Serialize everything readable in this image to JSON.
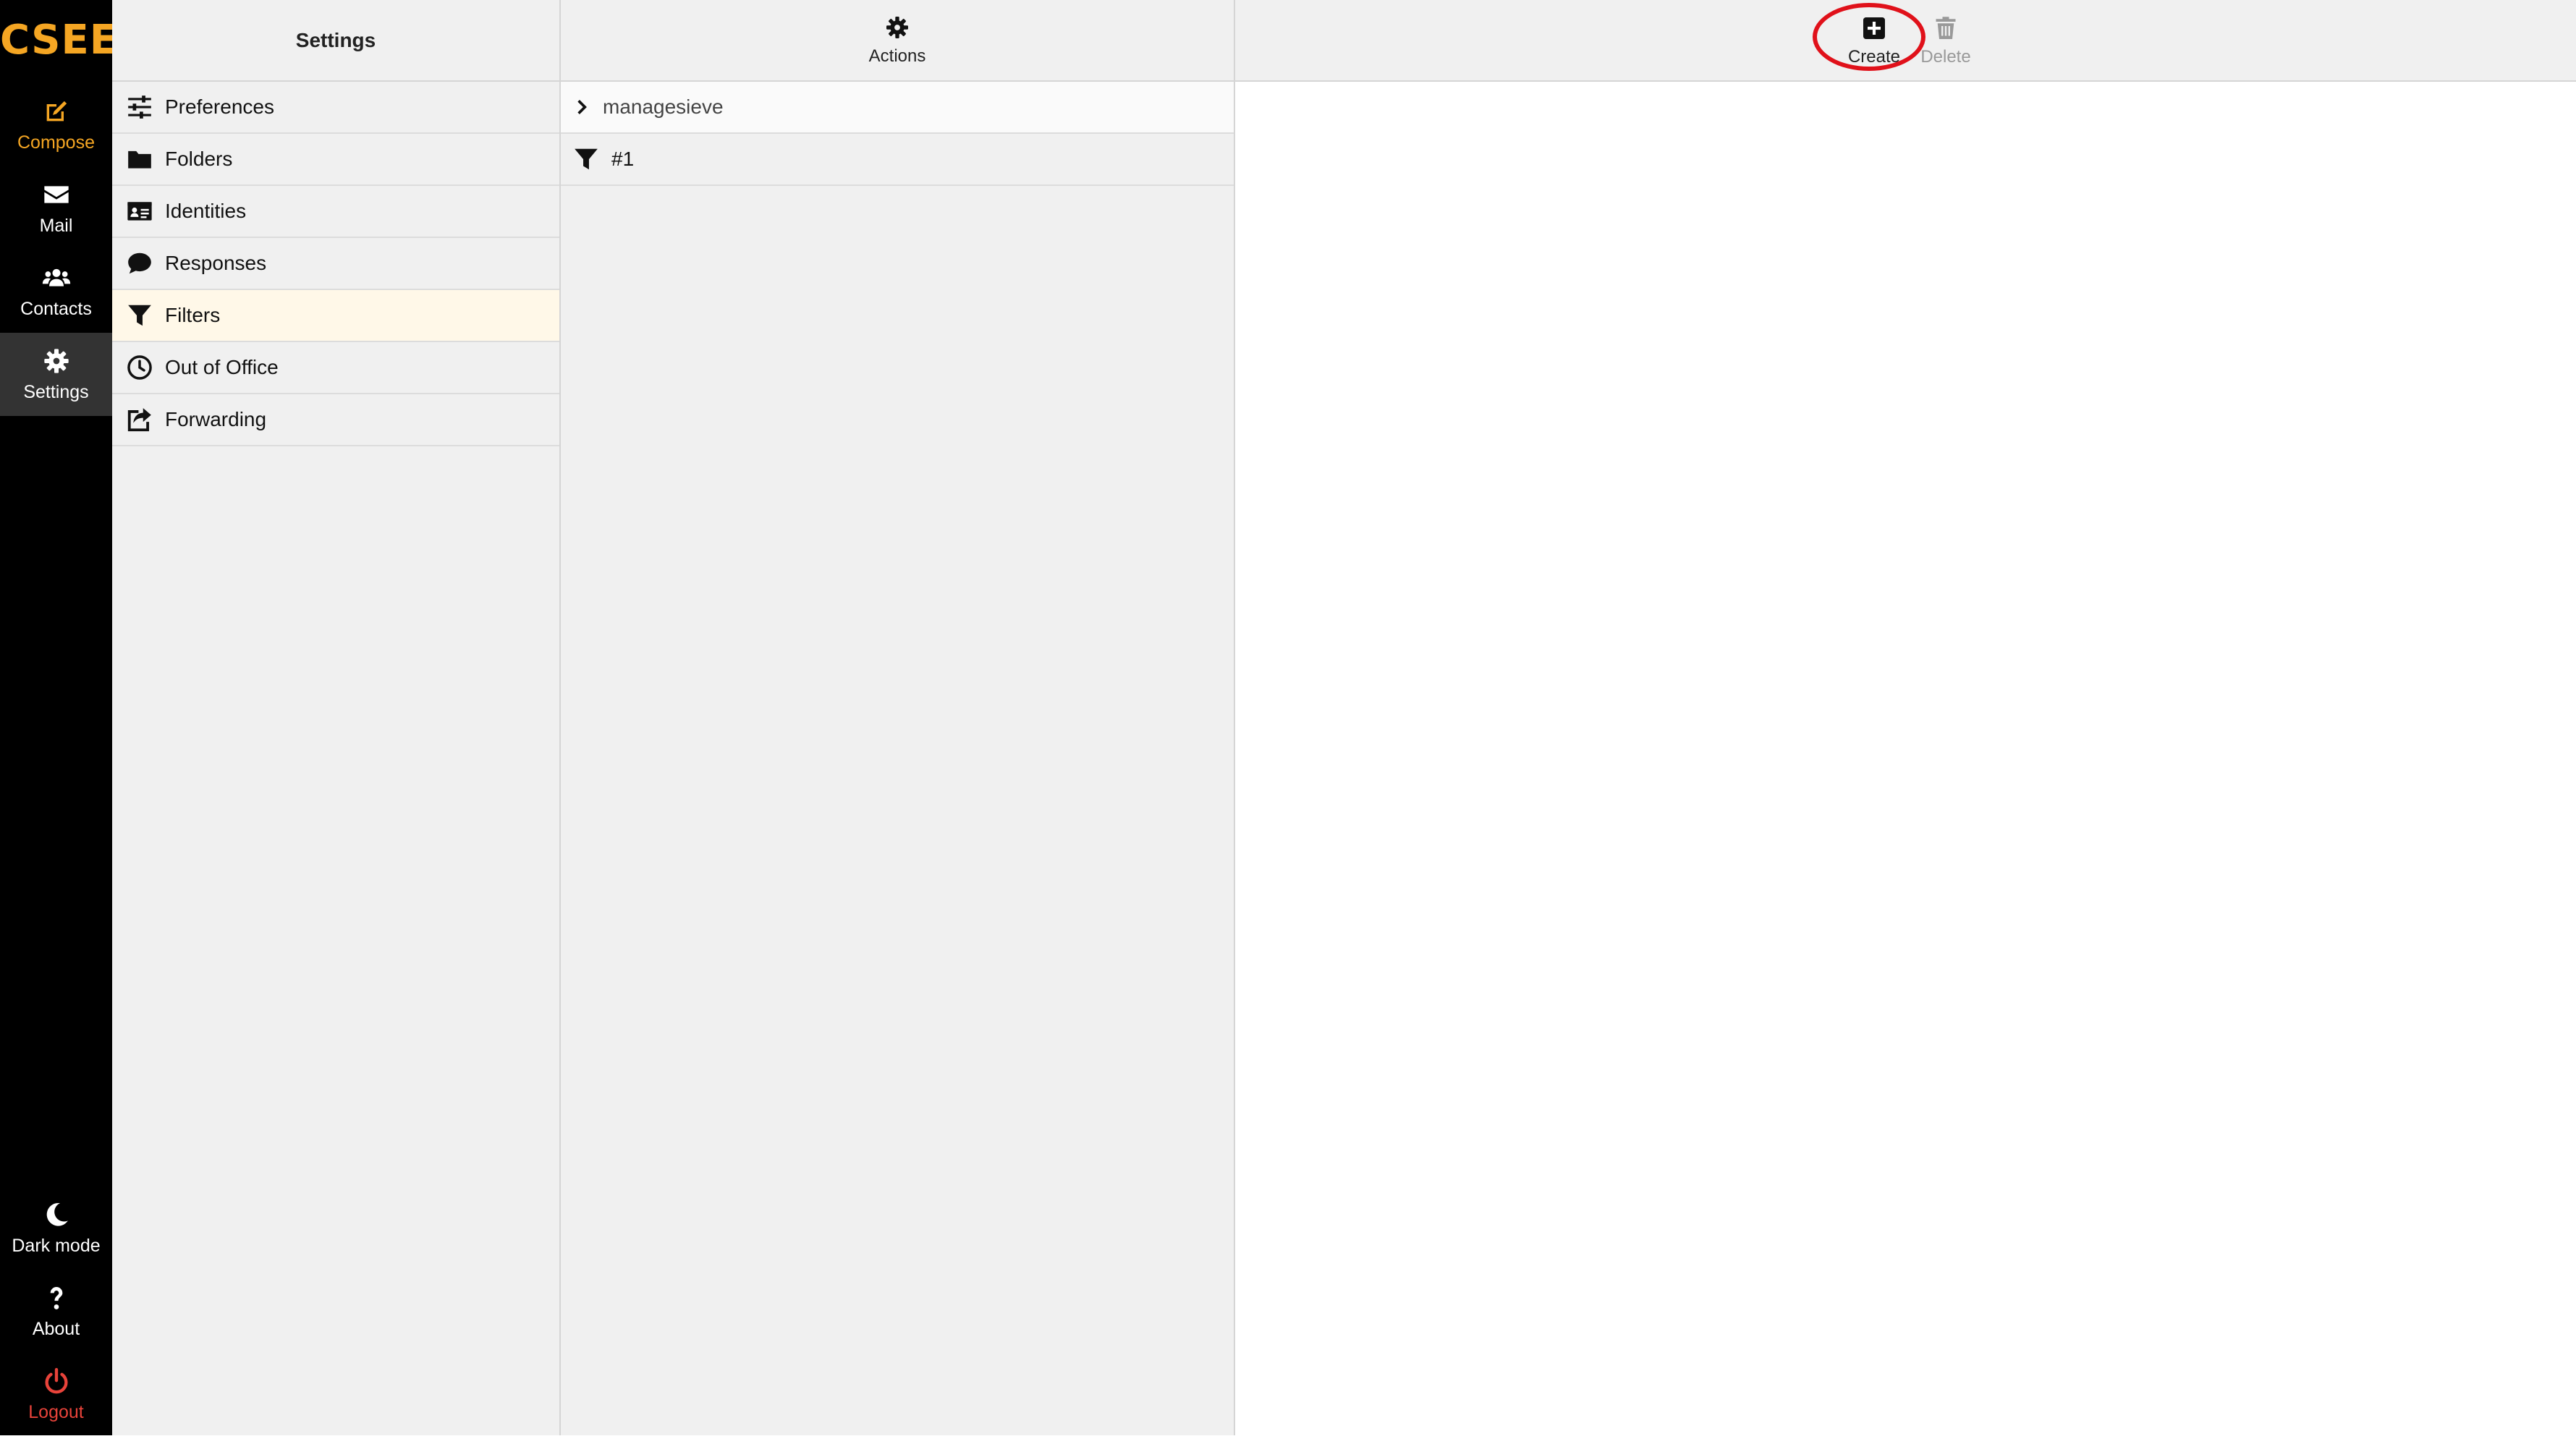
{
  "brand": {
    "logo": "CSEE",
    "accent": "#f5a623"
  },
  "nav": {
    "compose": "Compose",
    "mail": "Mail",
    "contacts": "Contacts",
    "settings": "Settings",
    "dark_mode": "Dark mode",
    "about": "About",
    "logout": "Logout"
  },
  "settings_panel": {
    "title": "Settings",
    "items": [
      {
        "label": "Preferences",
        "icon": "sliders-icon"
      },
      {
        "label": "Folders",
        "icon": "folder-icon"
      },
      {
        "label": "Identities",
        "icon": "id-card-icon"
      },
      {
        "label": "Responses",
        "icon": "comment-icon"
      },
      {
        "label": "Filters",
        "icon": "filter-icon",
        "selected": true
      },
      {
        "label": "Out of Office",
        "icon": "clock-icon"
      },
      {
        "label": "Forwarding",
        "icon": "share-icon"
      }
    ]
  },
  "filters_panel": {
    "actions_label": "Actions",
    "filter_set": "managesieve",
    "filters": [
      {
        "label": "#1"
      }
    ]
  },
  "content_toolbar": {
    "create_label": "Create",
    "delete_label": "Delete",
    "delete_disabled": true
  },
  "colors": {
    "nav_bg": "#000000",
    "selected_row": "#fff8e8",
    "logout": "#e8433a",
    "highlight_ring": "#e0111a"
  }
}
